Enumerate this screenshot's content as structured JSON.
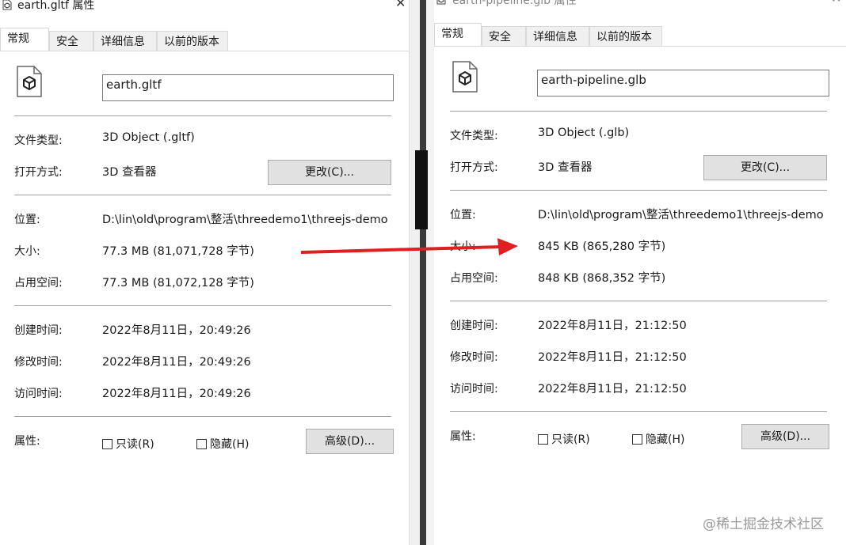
{
  "left": {
    "title": "earth.gltf 属性",
    "tabs": [
      "常规",
      "安全",
      "详细信息",
      "以前的版本"
    ],
    "filename": "earth.gltf",
    "rows": {
      "type_label": "文件类型:",
      "type_value": "3D Object (.gltf)",
      "open_label": "打开方式:",
      "open_value": "3D 查看器",
      "change_button": "更改(C)...",
      "location_label": "位置:",
      "location_value": "D:\\lin\\old\\program\\整活\\threedemo1\\threejs-demo",
      "size_label": "大小:",
      "size_value": "77.3 MB (81,071,728 字节)",
      "disk_label": "占用空间:",
      "disk_value": "77.3 MB (81,072,128 字节)",
      "created_label": "创建时间:",
      "created_value": "2022年8月11日，20:49:26",
      "modified_label": "修改时间:",
      "modified_value": "2022年8月11日，20:49:26",
      "accessed_label": "访问时间:",
      "accessed_value": "2022年8月11日，20:49:26",
      "attr_label": "属性:",
      "readonly": "只读(R)",
      "hidden": "隐藏(H)",
      "advanced_button": "高级(D)..."
    }
  },
  "right": {
    "title": "earth-pipeline.glb 属性",
    "tabs": [
      "常规",
      "安全",
      "详细信息",
      "以前的版本"
    ],
    "filename": "earth-pipeline.glb",
    "rows": {
      "type_label": "文件类型:",
      "type_value": "3D Object (.glb)",
      "open_label": "打开方式:",
      "open_value": "3D 查看器",
      "change_button": "更改(C)...",
      "location_label": "位置:",
      "location_value": "D:\\lin\\old\\program\\整活\\threedemo1\\threejs-demo",
      "size_label": "大小:",
      "size_value": "845 KB (865,280 字节)",
      "disk_label": "占用空间:",
      "disk_value": "848 KB (868,352 字节)",
      "created_label": "创建时间:",
      "created_value": "2022年8月11日，21:12:50",
      "modified_label": "修改时间:",
      "modified_value": "2022年8月11日，21:12:50",
      "accessed_label": "访问时间:",
      "accessed_value": "2022年8月11日，21:12:50",
      "attr_label": "属性:",
      "readonly": "只读(R)",
      "hidden": "隐藏(H)",
      "advanced_button": "高级(D)..."
    }
  },
  "close_glyph": "✕",
  "watermark": "@稀土掘金技术社区",
  "colors": {
    "arrow": "#e02020",
    "button_bg": "#e1e1e1",
    "separator": "#a0a0a0"
  }
}
